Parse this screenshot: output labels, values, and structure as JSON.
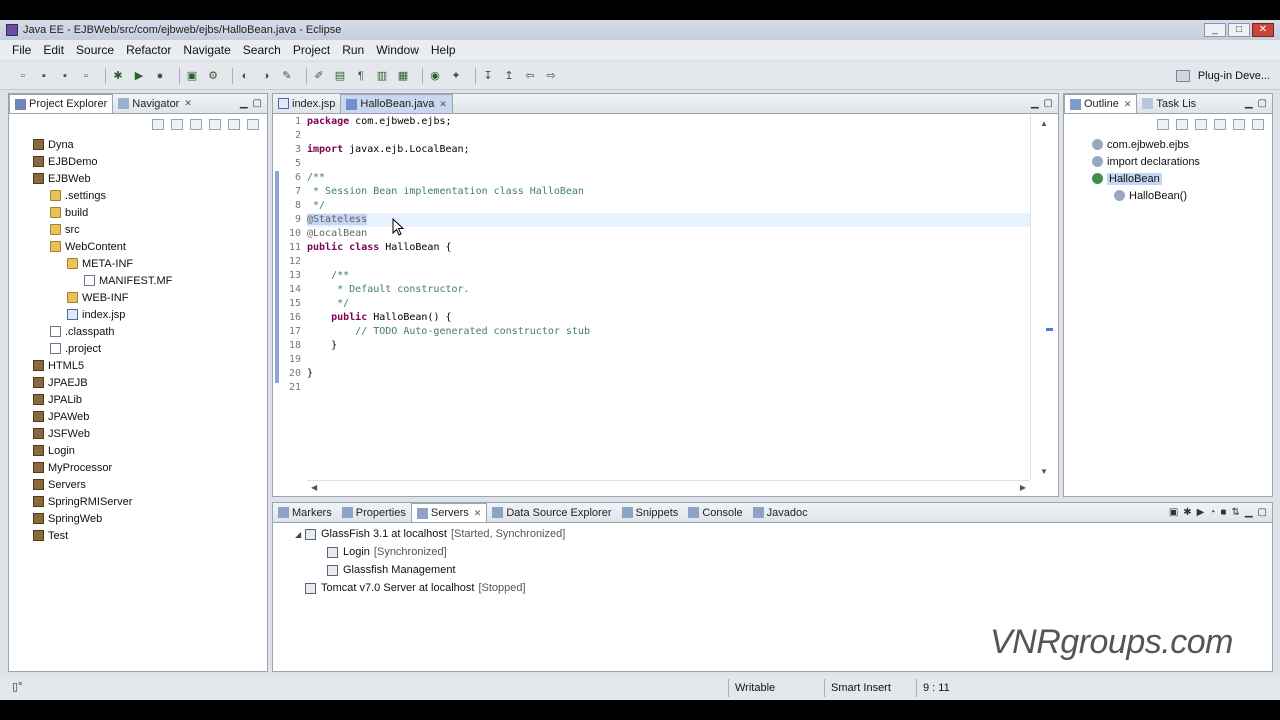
{
  "window": {
    "title": "Java EE - EJBWeb/src/com/ejbweb/ejbs/HalloBean.java - Eclipse",
    "controls": [
      "_",
      "□",
      "✕"
    ]
  },
  "menubar": [
    "File",
    "Edit",
    "Source",
    "Refactor",
    "Navigate",
    "Search",
    "Project",
    "Run",
    "Window",
    "Help"
  ],
  "toolbar": {
    "perspective_label": "Plug-in Deve..."
  },
  "explorer": {
    "tabs": [
      {
        "label": "Project Explorer",
        "active": true
      },
      {
        "label": "Navigator",
        "active": false,
        "close": "✕"
      }
    ],
    "tree": [
      {
        "label": "Dyna",
        "indent": 0,
        "kind": "project"
      },
      {
        "label": "EJBDemo",
        "indent": 0,
        "kind": "project"
      },
      {
        "label": "EJBWeb",
        "indent": 0,
        "kind": "project"
      },
      {
        "label": ".settings",
        "indent": 1,
        "kind": "folder"
      },
      {
        "label": "build",
        "indent": 1,
        "kind": "folder"
      },
      {
        "label": "src",
        "indent": 1,
        "kind": "folder"
      },
      {
        "label": "WebContent",
        "indent": 1,
        "kind": "folder"
      },
      {
        "label": "META-INF",
        "indent": 2,
        "kind": "folder"
      },
      {
        "label": "MANIFEST.MF",
        "indent": 3,
        "kind": "file"
      },
      {
        "label": "WEB-INF",
        "indent": 2,
        "kind": "folder"
      },
      {
        "label": "index.jsp",
        "indent": 2,
        "kind": "jsp"
      },
      {
        "label": ".classpath",
        "indent": 1,
        "kind": "file"
      },
      {
        "label": ".project",
        "indent": 1,
        "kind": "file"
      },
      {
        "label": "HTML5",
        "indent": 0,
        "kind": "project"
      },
      {
        "label": "JPAEJB",
        "indent": 0,
        "kind": "project"
      },
      {
        "label": "JPALib",
        "indent": 0,
        "kind": "project"
      },
      {
        "label": "JPAWeb",
        "indent": 0,
        "kind": "project"
      },
      {
        "label": "JSFWeb",
        "indent": 0,
        "kind": "project"
      },
      {
        "label": "Login",
        "indent": 0,
        "kind": "project"
      },
      {
        "label": "MyProcessor",
        "indent": 0,
        "kind": "project"
      },
      {
        "label": "Servers",
        "indent": 0,
        "kind": "project"
      },
      {
        "label": "SpringRMIServer",
        "indent": 0,
        "kind": "project"
      },
      {
        "label": "SpringWeb",
        "indent": 0,
        "kind": "project"
      },
      {
        "label": "Test",
        "indent": 0,
        "kind": "project"
      }
    ]
  },
  "editor": {
    "tabs": [
      {
        "label": "index.jsp",
        "active": false
      },
      {
        "label": "HalloBean.java",
        "active": true,
        "close": "✕"
      }
    ],
    "lines": [
      {
        "n": "1",
        "tokens": [
          [
            "kw",
            "package"
          ],
          [
            "txt",
            " com.ejbweb.ejbs;"
          ]
        ]
      },
      {
        "n": "2",
        "tokens": []
      },
      {
        "n": "3",
        "tokens": [
          [
            "kw",
            "import"
          ],
          [
            "txt",
            " javax.ejb.LocalBean;"
          ]
        ]
      },
      {
        "n": "5",
        "tokens": []
      },
      {
        "n": "6",
        "tokens": [
          [
            "cm",
            "/**"
          ]
        ]
      },
      {
        "n": "7",
        "tokens": [
          [
            "cm",
            " * Session Bean implementation class HalloBean"
          ]
        ]
      },
      {
        "n": "8",
        "tokens": [
          [
            "cm",
            " */"
          ]
        ]
      },
      {
        "n": "9",
        "tokens": [
          [
            "an",
            "@Stateless"
          ]
        ],
        "highlight": true
      },
      {
        "n": "10",
        "tokens": [
          [
            "an",
            "@LocalBean"
          ]
        ]
      },
      {
        "n": "11",
        "tokens": [
          [
            "kw",
            "public"
          ],
          [
            "txt",
            " "
          ],
          [
            "kw",
            "class"
          ],
          [
            "txt",
            " HalloBean {"
          ]
        ]
      },
      {
        "n": "12",
        "tokens": []
      },
      {
        "n": "13",
        "tokens": [
          [
            "cm",
            "    /**"
          ]
        ]
      },
      {
        "n": "14",
        "tokens": [
          [
            "cm",
            "     * Default constructor."
          ]
        ]
      },
      {
        "n": "15",
        "tokens": [
          [
            "cm",
            "     */"
          ]
        ]
      },
      {
        "n": "16",
        "tokens": [
          [
            "txt",
            "    "
          ],
          [
            "kw",
            "public"
          ],
          [
            "txt",
            " HalloBean() {"
          ]
        ]
      },
      {
        "n": "17",
        "tokens": [
          [
            "cm",
            "        // TODO Auto-generated constructor stub"
          ]
        ]
      },
      {
        "n": "18",
        "tokens": [
          [
            "txt",
            "    }"
          ]
        ]
      },
      {
        "n": "19",
        "tokens": []
      },
      {
        "n": "20",
        "tokens": [
          [
            "txt",
            "}"
          ]
        ]
      },
      {
        "n": "21",
        "tokens": []
      }
    ]
  },
  "outline": {
    "tabs": [
      {
        "label": "Outline",
        "active": true,
        "close": "✕"
      },
      {
        "label": "Task Lis",
        "active": false
      }
    ],
    "items": [
      {
        "label": "com.ejbweb.ejbs",
        "indent": 0
      },
      {
        "label": "import declarations",
        "indent": 0
      },
      {
        "label": "HalloBean",
        "indent": 0,
        "selected": true
      },
      {
        "label": "HalloBean()",
        "indent": 1
      }
    ]
  },
  "servers": {
    "tabs": [
      {
        "label": "Markers",
        "active": false
      },
      {
        "label": "Properties",
        "active": false
      },
      {
        "label": "Servers",
        "active": true,
        "close": "✕"
      },
      {
        "label": "Data Source Explorer",
        "active": false
      },
      {
        "label": "Snippets",
        "active": false
      },
      {
        "label": "Console",
        "active": false
      },
      {
        "label": "Javadoc",
        "active": false
      }
    ],
    "rows": [
      {
        "label": "GlassFish 3.1 at localhost",
        "status": "[Started, Synchronized]",
        "indent": 0,
        "expanded": true
      },
      {
        "label": "Login",
        "status": "[Synchronized]",
        "indent": 1
      },
      {
        "label": "Glassfish Management",
        "status": "",
        "indent": 1
      },
      {
        "label": "Tomcat v7.0 Server at localhost",
        "status": "[Stopped]",
        "indent": 0
      }
    ]
  },
  "statusbar": {
    "writable": "Writable",
    "insert_mode": "Smart Insert",
    "position": "9 : 11"
  },
  "watermark": "VNRgroups.com",
  "colors": {
    "keyword": "#7f0055",
    "comment": "#3f7f5f",
    "annotation": "#646464",
    "selection": "#c4d7f2"
  }
}
